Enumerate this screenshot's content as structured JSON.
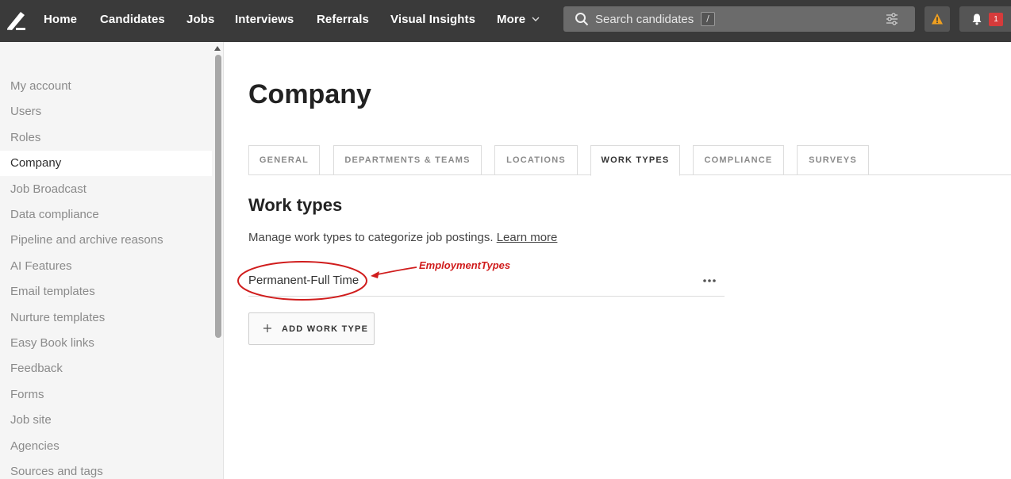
{
  "nav": {
    "items": [
      {
        "label": "Home"
      },
      {
        "label": "Candidates"
      },
      {
        "label": "Jobs"
      },
      {
        "label": "Interviews"
      },
      {
        "label": "Referrals"
      },
      {
        "label": "Visual Insights"
      },
      {
        "label": "More"
      }
    ],
    "search_placeholder": "Search candidates",
    "search_shortcut": "/",
    "notification_count": "1",
    "icons": [
      "logo-icon",
      "chevron-down-icon",
      "search-icon",
      "filter-sliders-icon",
      "warning-icon",
      "bell-icon"
    ]
  },
  "sidebar": {
    "items": [
      {
        "label": "My account"
      },
      {
        "label": "Users"
      },
      {
        "label": "Roles"
      },
      {
        "label": "Company",
        "active": true
      },
      {
        "label": "Job Broadcast"
      },
      {
        "label": "Data compliance"
      },
      {
        "label": "Pipeline and archive reasons"
      },
      {
        "label": "AI Features"
      },
      {
        "label": "Email templates"
      },
      {
        "label": "Nurture templates"
      },
      {
        "label": "Easy Book links"
      },
      {
        "label": "Feedback"
      },
      {
        "label": "Forms"
      },
      {
        "label": "Job site"
      },
      {
        "label": "Agencies"
      },
      {
        "label": "Sources and tags"
      }
    ]
  },
  "main": {
    "title": "Company",
    "tabs": [
      {
        "label": "GENERAL"
      },
      {
        "label": "DEPARTMENTS & TEAMS"
      },
      {
        "label": "LOCATIONS"
      },
      {
        "label": "WORK TYPES",
        "active": true
      },
      {
        "label": "COMPLIANCE"
      },
      {
        "label": "SURVEYS"
      }
    ],
    "section_title": "Work types",
    "section_desc": "Manage work types to categorize job postings.",
    "learn_more": "Learn more",
    "work_types": [
      {
        "name": "Permanent-Full Time"
      }
    ],
    "add_button": "ADD WORK TYPE",
    "annotation": "EmploymentTypes"
  },
  "colors": {
    "topbar": "#3a3a3a",
    "sidebar_bg": "#f5f5f5",
    "annotation_red": "#d01c1c",
    "badge_red": "#d63b3b",
    "warning_orange": "#f0a020"
  }
}
